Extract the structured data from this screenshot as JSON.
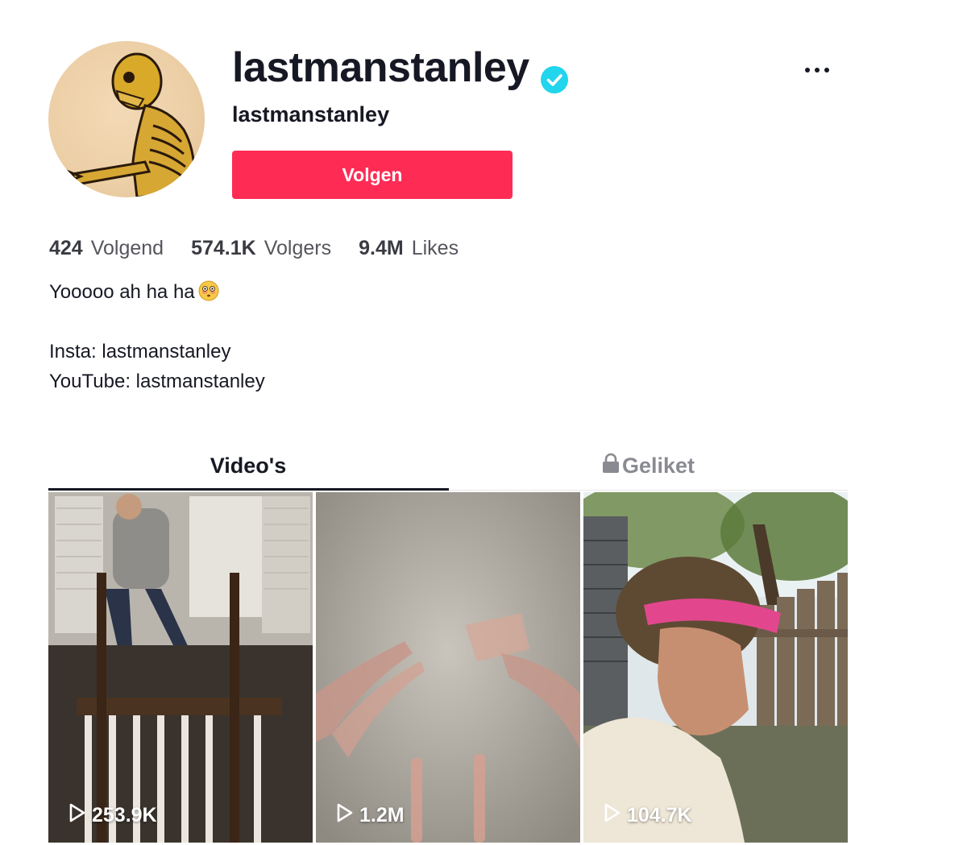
{
  "profile": {
    "username": "lastmanstanley",
    "nickname": "lastmanstanley",
    "verified": true,
    "follow_label": "Volgen"
  },
  "stats": [
    {
      "value": "424",
      "label": "Volgend"
    },
    {
      "value": "574.1K",
      "label": "Volgers"
    },
    {
      "value": "9.4M",
      "label": "Likes"
    }
  ],
  "bio": {
    "line1": "Yooooo ah ha ha",
    "line1_emoji": "flushed-face-emoji",
    "line2": "Insta: lastmanstanley",
    "line3": "YouTube: lastmanstanley"
  },
  "tabs": {
    "videos": "Video's",
    "liked": "Geliket",
    "active": "videos"
  },
  "videos": [
    {
      "views": "253.9K"
    },
    {
      "views": "1.2M"
    },
    {
      "views": "104.7K"
    }
  ],
  "colors": {
    "accent": "#fe2c55",
    "verified": "#20d5ec",
    "text": "#161823",
    "muted": "#8a8b91"
  }
}
